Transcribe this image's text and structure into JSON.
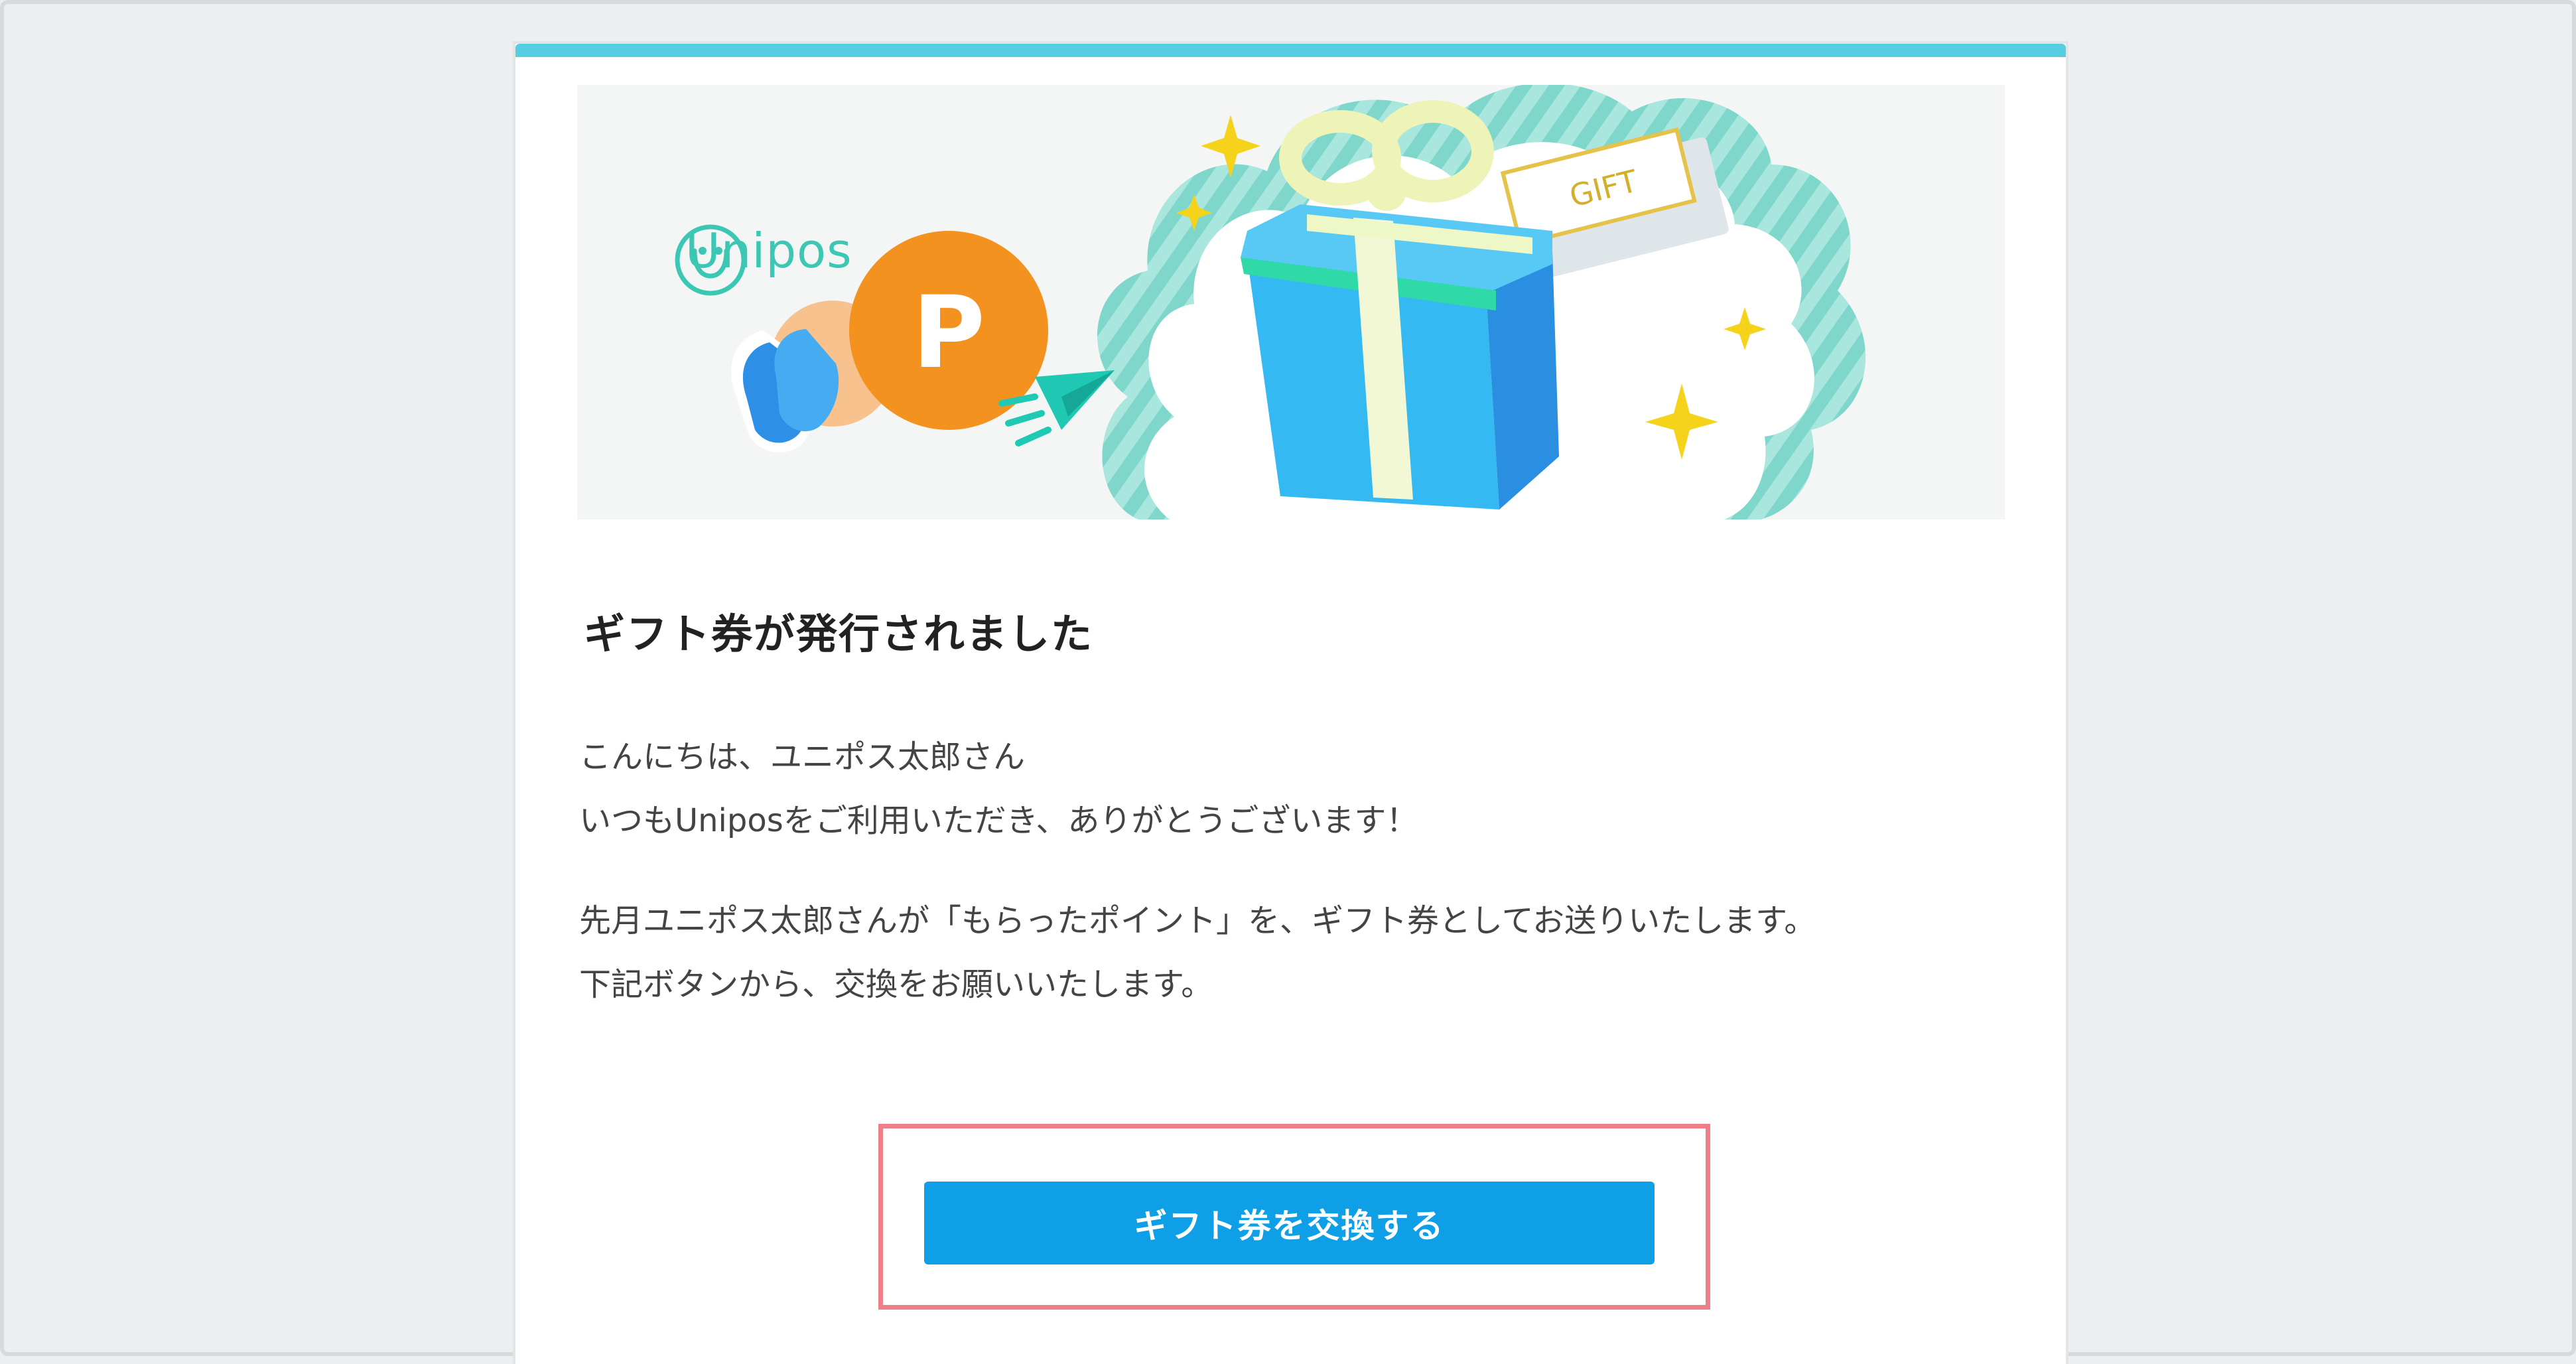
{
  "brand": {
    "name": "Unipos",
    "accent": "#3cc7b5",
    "topbar_color": "#56cde0"
  },
  "hero": {
    "point_badge": "P",
    "gift_tag": "GIFT"
  },
  "email": {
    "title": "ギフト券が発行されました",
    "greeting_lines": [
      "こんにちは、ユニポス太郎さん",
      "いつもUniposをご利用いただき、ありがとうございます！"
    ],
    "body_lines": [
      "先月ユニポス太郎さんが「もらったポイント」を、ギフト券としてお送りいたします。",
      "下記ボタンから、交換をお願いいたします。"
    ]
  },
  "cta": {
    "label": "ギフト券を交換する",
    "color": "#0e9fe6",
    "highlight_color": "#ee7f86"
  }
}
